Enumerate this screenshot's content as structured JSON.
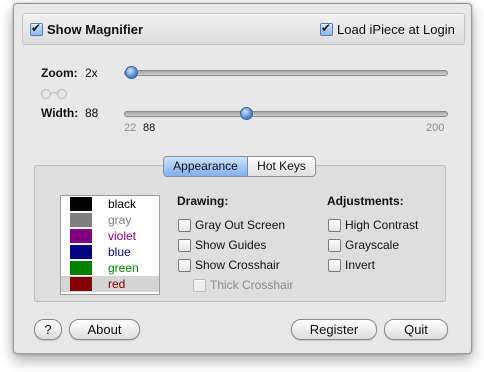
{
  "top": {
    "show_magnifier": "Show Magnifier",
    "load_at_login": "Load iPiece at Login"
  },
  "zoom": {
    "label": "Zoom:",
    "value": "2x",
    "level": 0.0
  },
  "width": {
    "label": "Width:",
    "value": "88",
    "min": "22",
    "current": "88",
    "max": "200",
    "level": 88
  },
  "tabs": [
    {
      "label": "Appearance"
    },
    {
      "label": "Hot Keys"
    }
  ],
  "colors": [
    {
      "name": "black",
      "swatch": "#000000",
      "text": "#000000"
    },
    {
      "name": "gray",
      "swatch": "#7f7f7f",
      "text": "#7f7f7f"
    },
    {
      "name": "violet",
      "swatch": "#800080",
      "text": "#800080"
    },
    {
      "name": "blue",
      "swatch": "#000080",
      "text": "#000080"
    },
    {
      "name": "green",
      "swatch": "#008000",
      "text": "#008000"
    },
    {
      "name": "red",
      "swatch": "#800000",
      "text": "#800000"
    }
  ],
  "drawing": {
    "title": "Drawing:",
    "gray_out": "Gray Out Screen",
    "show_guides": "Show Guides",
    "show_crosshair": "Show Crosshair",
    "thick_crosshair": "Thick Crosshair"
  },
  "adjustments": {
    "title": "Adjustments:",
    "high_contrast": "High Contrast",
    "grayscale": "Grayscale",
    "invert": "Invert"
  },
  "buttons": {
    "help": "?",
    "about": "About",
    "register": "Register",
    "quit": "Quit"
  }
}
